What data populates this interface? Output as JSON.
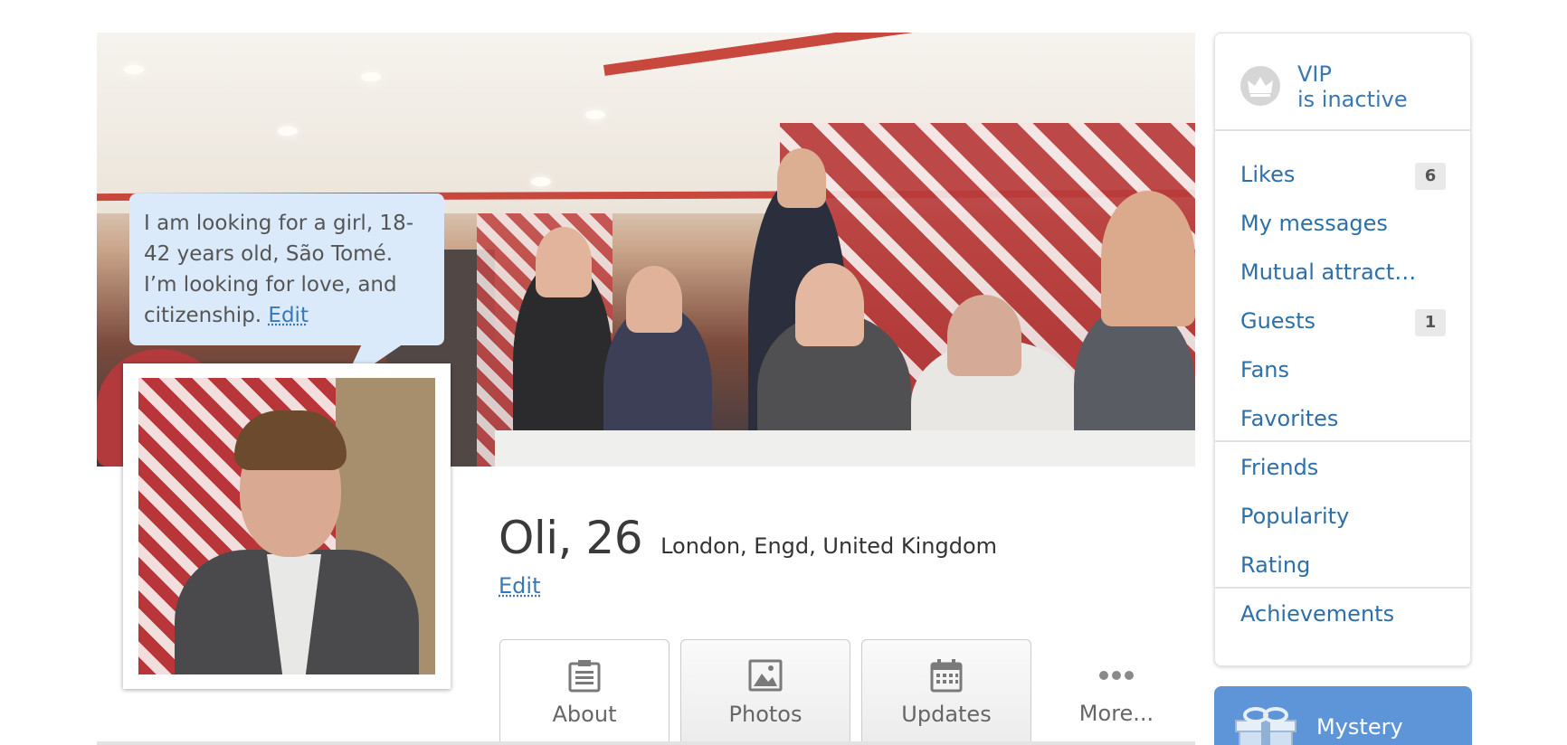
{
  "bubble": {
    "text": "I am looking for a girl, 18-42 years old, São Tomé. I’m looking for love, and citizenship.",
    "edit_label": "Edit"
  },
  "profile": {
    "name_age": "Oli, 26",
    "location": "London, Engd, United Kingdom",
    "edit_label": "Edit"
  },
  "tabs": [
    {
      "label": "About",
      "icon": "clipboard-icon",
      "active": true
    },
    {
      "label": "Photos",
      "icon": "image-icon",
      "active": false
    },
    {
      "label": "Updates",
      "icon": "calendar-icon",
      "active": false
    },
    {
      "label": "More...",
      "icon": "more-dots-icon",
      "active": false
    }
  ],
  "vip": {
    "line1": "VIP",
    "line2": "is inactive",
    "icon": "crown-icon"
  },
  "sidebar": {
    "items": [
      {
        "label": "Likes",
        "badge": "6"
      },
      {
        "label": "My messages"
      },
      {
        "label": "Mutual attract…"
      },
      {
        "label": "Guests",
        "badge": "1"
      },
      {
        "label": "Fans"
      },
      {
        "label": "Favorites"
      },
      {
        "label": "Friends"
      },
      {
        "label": "Popularity"
      },
      {
        "label": "Rating"
      },
      {
        "label": "Achievements"
      }
    ]
  },
  "mystery": {
    "label": "Mystery",
    "icon": "gift-icon"
  },
  "colors": {
    "link": "#2d6fa8",
    "bubble": "#dbeafb",
    "mystery_bg": "#5e95d8"
  }
}
